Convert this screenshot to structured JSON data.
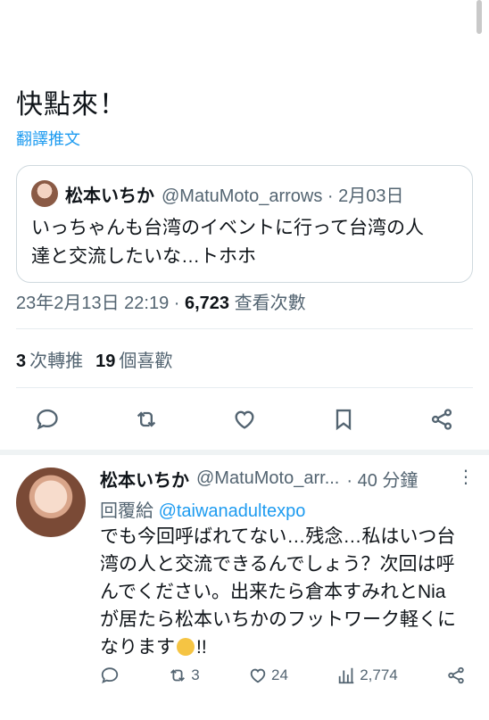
{
  "tweet": {
    "text": "快點來！",
    "translate_label": "翻譯推文"
  },
  "quote": {
    "name": "松本いちか",
    "handle": "@MatuMoto_arrows · 2月03日",
    "body_line1": "いっちゃんも台湾のイベントに行って台湾の人",
    "body_line2": "達と交流したいな…トホホ"
  },
  "meta": {
    "timestamp": "23年2月13日 22:19 · ",
    "views_count": "6,723",
    "views_label": " 查看次數"
  },
  "stats": {
    "retweets_count": "3",
    "retweets_label": "次轉推",
    "likes_count": "19",
    "likes_label": "個喜歡"
  },
  "actions": [
    "reply-icon",
    "retweet-icon",
    "like-icon",
    "bookmark-icon",
    "share-icon"
  ],
  "reply": {
    "name": "松本いちか",
    "handle": "@MatuMoto_arr...",
    "time": "· 40 分鐘",
    "more": "⋮",
    "replying_to_label": "回覆給 ",
    "replying_to_user": "@taiwanadultexpo",
    "body_line1": "でも今回呼ばれてない…残念…私はいつ台",
    "body_line2": "湾の人と交流できるんでしょう？次回は呼",
    "body_line3": "んでください。出来たら倉本すみれとNia",
    "body_line4": "が居たら松本いちかのフットワーク軽くに",
    "body_line5_before": "なります",
    "body_line5_after": "!!",
    "retweet_count": "3",
    "like_count": "24",
    "views_count": "2,774"
  },
  "colors": {
    "accent": "#1d9bf0",
    "text": "#0f1419",
    "muted": "#536471",
    "divider": "#e6ecf0"
  }
}
